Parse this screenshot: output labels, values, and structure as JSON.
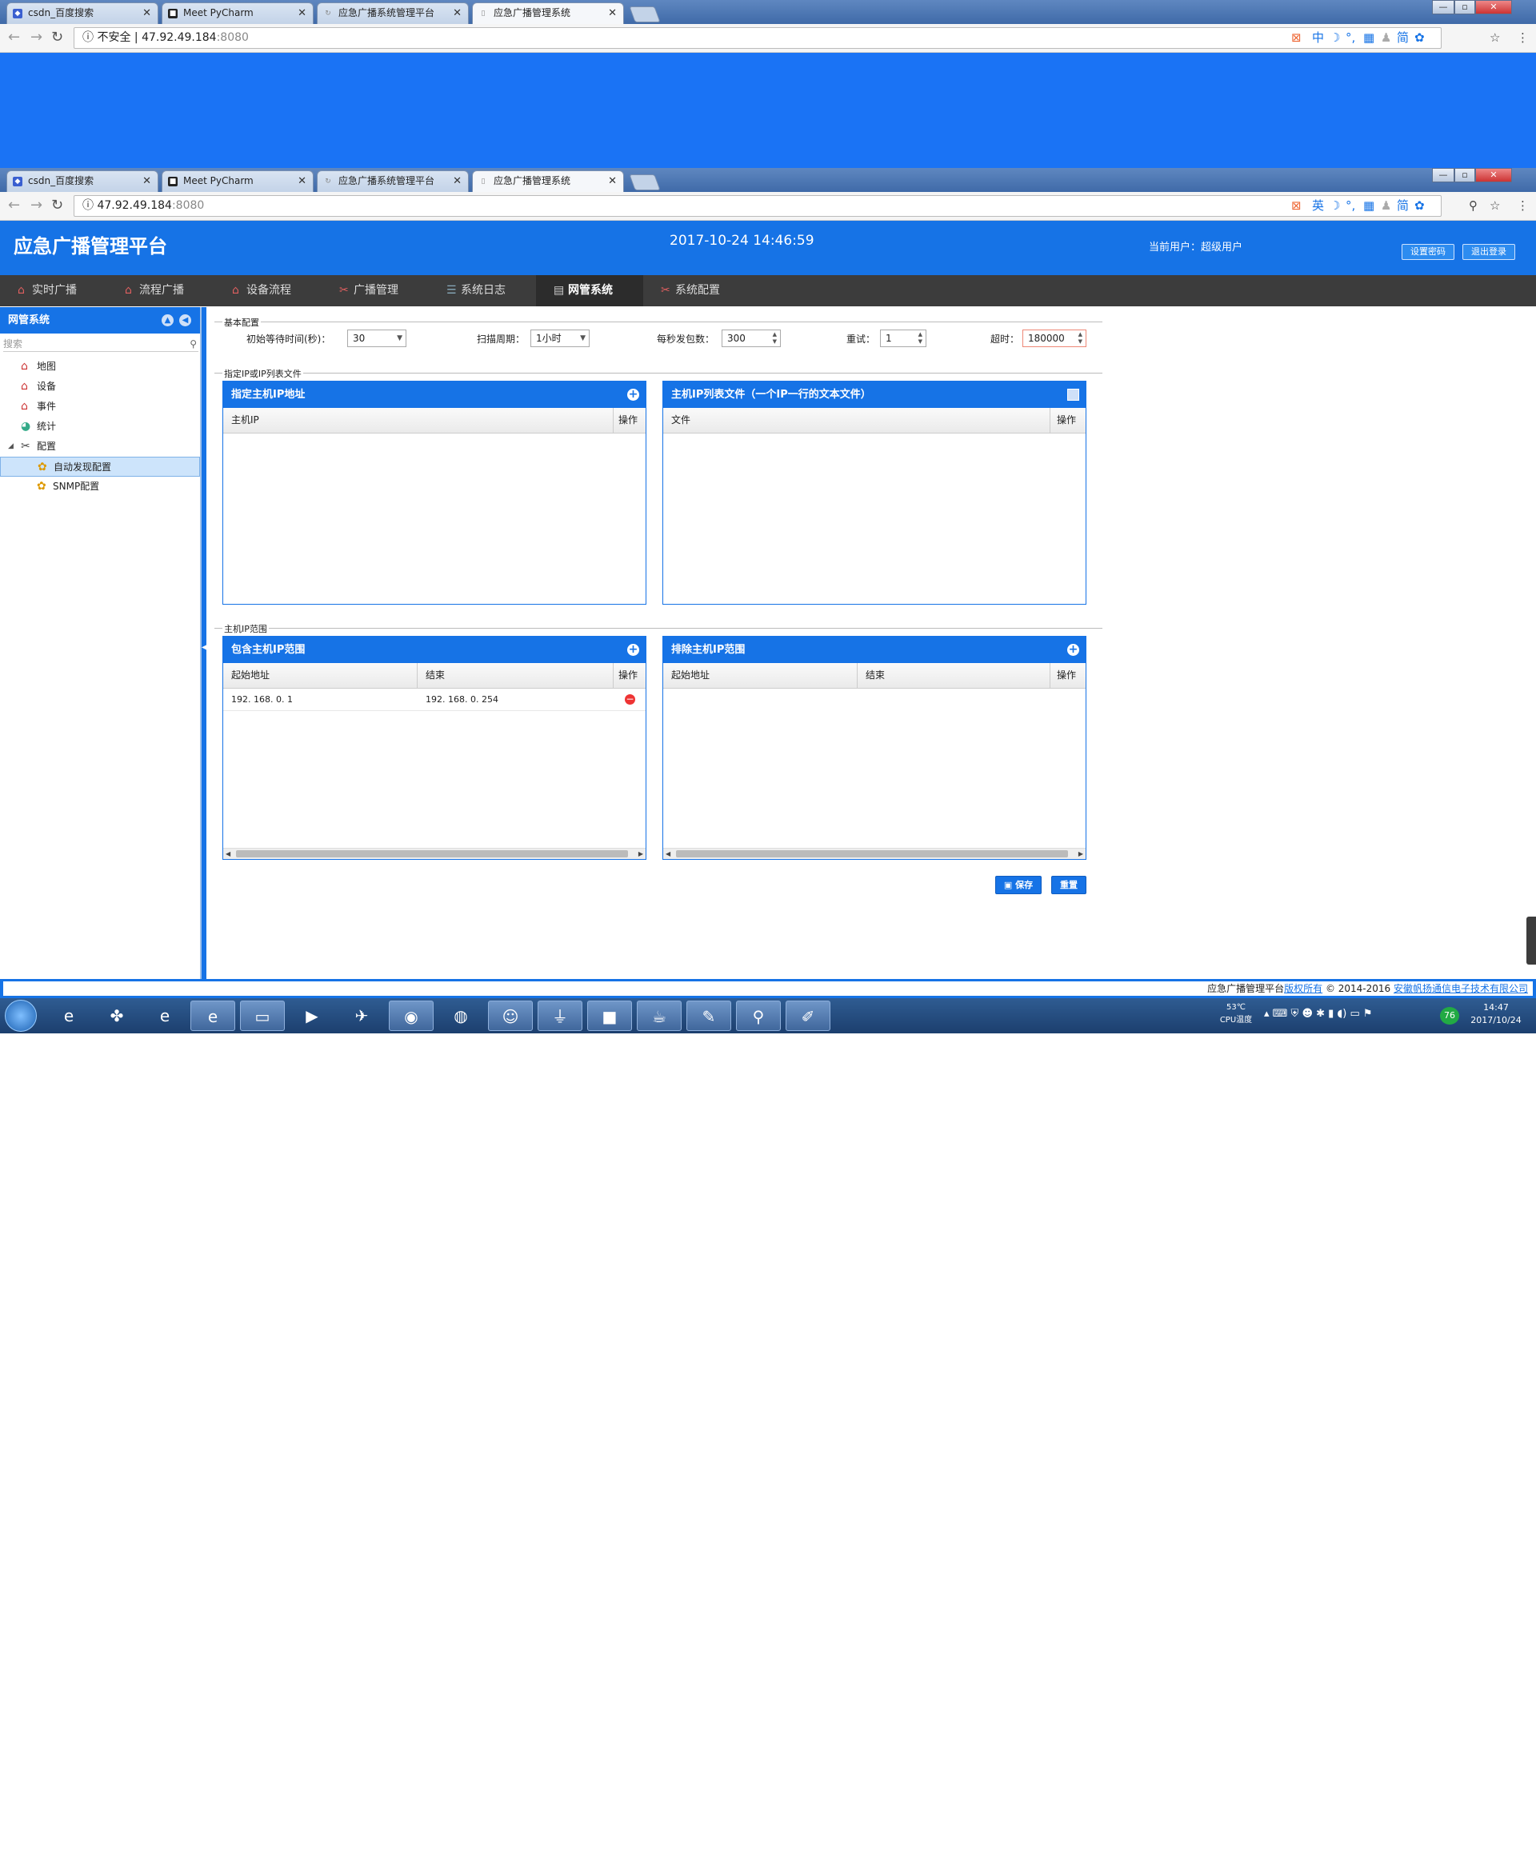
{
  "browser": {
    "tabs": [
      {
        "label": "csdn_百度搜索",
        "icon": "baidu-paw-icon",
        "color": "#3a5fd0"
      },
      {
        "label": "Meet PyCharm",
        "icon": "pycharm-icon",
        "color": "#222222"
      },
      {
        "label": "应急广播系统管理平台",
        "icon": "loading-icon",
        "color": "#888888"
      },
      {
        "label": "应急广播管理系统",
        "icon": "document-icon",
        "color": "#888888"
      }
    ],
    "address_top": {
      "security": "不安全",
      "host": "47.92.49.184",
      "port": ":8080"
    },
    "address_bottom": {
      "host": "47.92.49.184",
      "port": ":8080"
    },
    "ime_top": "中",
    "ime_bottom": "英",
    "ime_simplified": "简"
  },
  "app": {
    "title": "应急广播管理平台",
    "datetime": "2017-10-24  14:46:59",
    "current_user": "当前用户：超级用户",
    "set_password": "设置密码",
    "logout": "退出登录",
    "menu": [
      {
        "label": "实时广播",
        "icon": "home-icon"
      },
      {
        "label": "流程广播",
        "icon": "home-icon"
      },
      {
        "label": "设备流程",
        "icon": "home-icon"
      },
      {
        "label": "广播管理",
        "icon": "tools-icon"
      },
      {
        "label": "系统日志",
        "icon": "list-icon"
      },
      {
        "label": "网管系统",
        "icon": "network-icon"
      },
      {
        "label": "系统配置",
        "icon": "tools-icon"
      }
    ],
    "active_menu": "网管系统"
  },
  "sidebar": {
    "title": "网管系统",
    "search_placeholder": "搜索",
    "tree": [
      {
        "label": "地图",
        "icon": "home-icon",
        "level": 1
      },
      {
        "label": "设备",
        "icon": "home-icon",
        "level": 1
      },
      {
        "label": "事件",
        "icon": "home-icon",
        "level": 1
      },
      {
        "label": "统计",
        "icon": "chart-icon",
        "level": 1
      },
      {
        "label": "配置",
        "icon": "tools-icon",
        "level": 1
      },
      {
        "label": "自动发现配置",
        "icon": "gear-icon",
        "level": 2,
        "selected": true
      },
      {
        "label": "SNMP配置",
        "icon": "gear-icon",
        "level": 2
      }
    ]
  },
  "basic_config": {
    "legend": "基本配置",
    "initial_wait_label": "初始等待时间(秒)：",
    "initial_wait_value": "30",
    "scan_period_label": "扫描周期：",
    "scan_period_value": "1小时",
    "packets_label": "每秒发包数：",
    "packets_value": "300",
    "retry_label": "重试：",
    "retry_value": "1",
    "timeout_label": "超时：",
    "timeout_value": "180000"
  },
  "ip_section": {
    "legend": "指定IP或IP列表文件",
    "ip_panel_title": "指定主机IP地址",
    "ip_col": "主机IP",
    "op_col": "操作",
    "file_panel_title": "主机IP列表文件（一个IP一行的文本文件）",
    "file_col": "文件"
  },
  "range_section": {
    "legend": "主机IP范围",
    "include_title": "包含主机IP范围",
    "exclude_title": "排除主机IP范围",
    "start_col": "起始地址",
    "end_col": "结束",
    "op_col": "操作",
    "include_rows": [
      {
        "start": "192. 168. 0. 1",
        "end": "192. 168. 0. 254"
      }
    ]
  },
  "actions": {
    "save": "保存",
    "reset": "重置"
  },
  "footer": {
    "platform": "应急广播管理平台",
    "rights": "版权所有",
    "copyright": " © 2014-2016 ",
    "company": "安徽帆扬通信电子技术有限公司"
  },
  "taskbar": {
    "cpu_temp": "53℃",
    "cpu_label": "CPU温度",
    "time": "14:47",
    "date": "2017/10/24",
    "badge": "76"
  }
}
